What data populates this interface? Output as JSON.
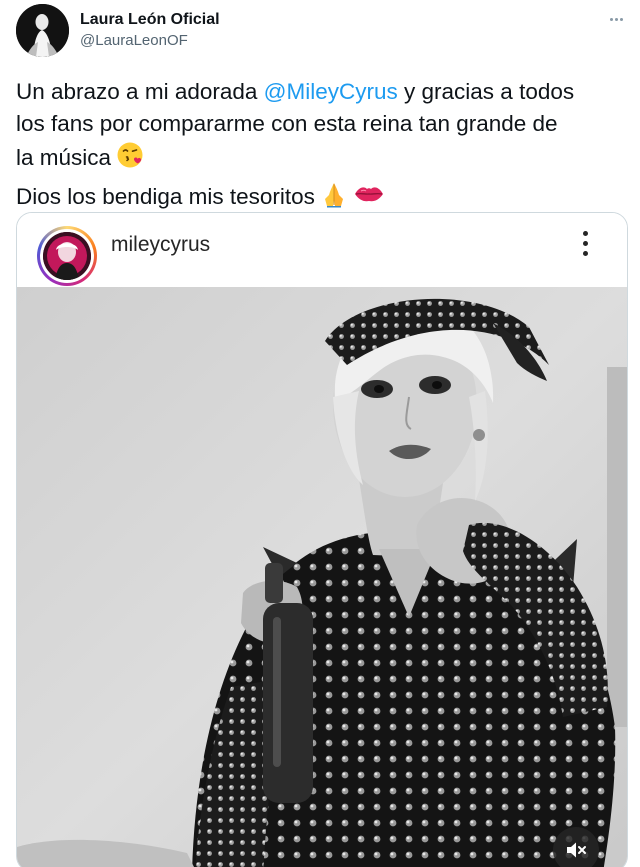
{
  "author": {
    "name": "Laura León Oficial",
    "handle": "@LauraLeonOF"
  },
  "tweet": {
    "lines": [
      {
        "before": "Un abrazo a mi adorada ",
        "mention": "@MileyCyrus",
        "after": " y gracias a todos"
      },
      {
        "text": "los fans por compararme con esta reina tan grande de"
      },
      {
        "text": "la música",
        "emoji": "face-blowing-kiss-emoji"
      },
      {
        "text": "Dios los bendiga mis tesoritos",
        "emojis": [
          "folded-hands-emoji",
          "kiss-mark-emoji"
        ]
      }
    ]
  },
  "embed": {
    "platform": "instagram",
    "username": "mileycyrus",
    "video": {
      "muted": true,
      "style": "black-and-white",
      "controls": [
        "more-options-icon",
        "muted-speaker-icon"
      ]
    }
  },
  "colors": {
    "mention": "#1d9bf0",
    "secondary_text": "#536471",
    "border": "#cfd9de",
    "emoji_face": "#ffcc33",
    "emoji_heart": "#e0245e",
    "emoji_hands": "#ffc83d",
    "lips": "#e0245e"
  }
}
